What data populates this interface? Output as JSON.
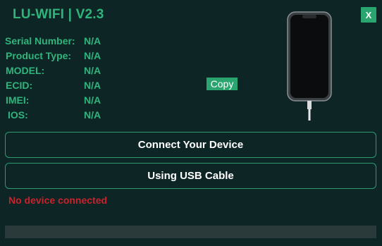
{
  "app": {
    "title": "LU-WIFI | V2.3",
    "close_label": "X"
  },
  "device_info": [
    {
      "label": "Serial Number:",
      "value": "N/A"
    },
    {
      "label": "Product Type:",
      "value": "N/A"
    },
    {
      "label": "MODEL:",
      "value": "N/A"
    },
    {
      "label": "ECID:",
      "value": "N/A"
    },
    {
      "label": "IMEI:",
      "value": "N/A"
    },
    {
      "label": "IOS:",
      "value": "N/A"
    }
  ],
  "copy_label": "Copy",
  "buttons": {
    "connect": "Connect Your Device",
    "usb": "Using USB Cable"
  },
  "status": "No device connected",
  "progress": 0,
  "colors": {
    "accent": "#2aa570",
    "background": "#0e2526",
    "error": "#c8232b"
  },
  "icons": {
    "device": "smartphone-with-cable-icon"
  }
}
